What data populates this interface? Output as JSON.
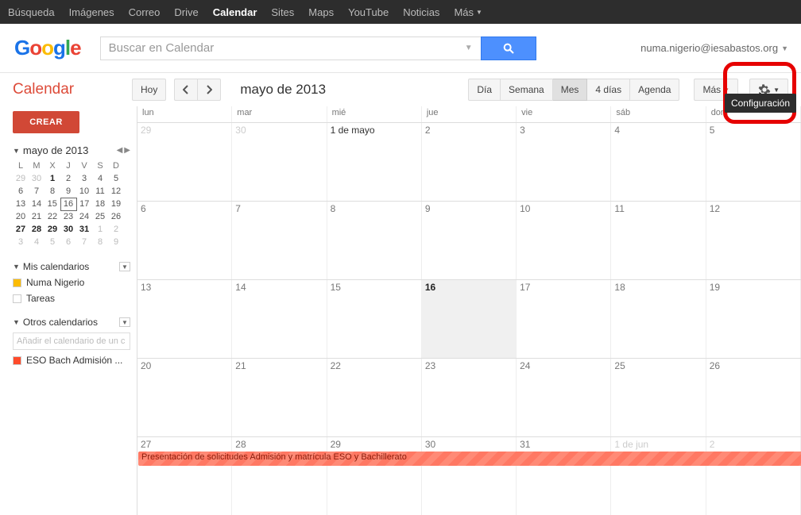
{
  "topnav": {
    "items": [
      "Búsqueda",
      "Imágenes",
      "Correo",
      "Drive",
      "Calendar",
      "Sites",
      "Maps",
      "YouTube",
      "Noticias"
    ],
    "more": "Más",
    "active": 4
  },
  "logo_letters": [
    "G",
    "o",
    "o",
    "g",
    "l",
    "e"
  ],
  "search": {
    "placeholder": "Buscar en Calendar"
  },
  "user": {
    "email": "numa.nigerio@iesabastos.org"
  },
  "app": {
    "title": "Calendar"
  },
  "toolbar": {
    "today": "Hoy",
    "month": "mayo de 2013",
    "views": [
      "Día",
      "Semana",
      "Mes",
      "4 días",
      "Agenda"
    ],
    "selected_view": 2,
    "more": "Más"
  },
  "tooltip": "Configuración",
  "sidebar": {
    "create": "CREAR",
    "mini": {
      "label": "mayo de 2013",
      "dow": [
        "L",
        "M",
        "X",
        "J",
        "V",
        "S",
        "D"
      ],
      "rows": [
        [
          {
            "n": "29",
            "dim": true
          },
          {
            "n": "30",
            "dim": true
          },
          {
            "n": "1",
            "b": true
          },
          {
            "n": "2"
          },
          {
            "n": "3"
          },
          {
            "n": "4"
          },
          {
            "n": "5"
          }
        ],
        [
          {
            "n": "6"
          },
          {
            "n": "7"
          },
          {
            "n": "8"
          },
          {
            "n": "9"
          },
          {
            "n": "10"
          },
          {
            "n": "11"
          },
          {
            "n": "12"
          }
        ],
        [
          {
            "n": "13"
          },
          {
            "n": "14"
          },
          {
            "n": "15"
          },
          {
            "n": "16",
            "today": true
          },
          {
            "n": "17"
          },
          {
            "n": "18"
          },
          {
            "n": "19"
          }
        ],
        [
          {
            "n": "20"
          },
          {
            "n": "21"
          },
          {
            "n": "22"
          },
          {
            "n": "23"
          },
          {
            "n": "24"
          },
          {
            "n": "25"
          },
          {
            "n": "26"
          }
        ],
        [
          {
            "n": "27",
            "b": true
          },
          {
            "n": "28",
            "b": true
          },
          {
            "n": "29",
            "b": true
          },
          {
            "n": "30",
            "b": true
          },
          {
            "n": "31",
            "b": true
          },
          {
            "n": "1",
            "dim": true
          },
          {
            "n": "2",
            "dim": true
          }
        ],
        [
          {
            "n": "3",
            "dim": true
          },
          {
            "n": "4",
            "dim": true
          },
          {
            "n": "5",
            "dim": true
          },
          {
            "n": "6",
            "dim": true
          },
          {
            "n": "7",
            "dim": true
          },
          {
            "n": "8",
            "dim": true
          },
          {
            "n": "9",
            "dim": true
          }
        ]
      ]
    },
    "mycals": {
      "title": "Mis calendarios",
      "items": [
        {
          "label": "Numa Nigerio",
          "color": "#fbbc05"
        },
        {
          "label": "Tareas",
          "color": "#ffffff"
        }
      ]
    },
    "othercals": {
      "title": "Otros calendarios",
      "add_placeholder": "Añadir el calendario de un c",
      "items": [
        {
          "label": "ESO Bach Admisión ...",
          "color": "#ff4b2b"
        }
      ]
    }
  },
  "grid": {
    "dow": [
      "lun",
      "mar",
      "mié",
      "jue",
      "vie",
      "sáb",
      "dom"
    ],
    "weeks": [
      [
        {
          "n": "29",
          "dim": true
        },
        {
          "n": "30",
          "dim": true
        },
        {
          "n": "1 de mayo",
          "first": true
        },
        {
          "n": "2"
        },
        {
          "n": "3"
        },
        {
          "n": "4"
        },
        {
          "n": "5"
        }
      ],
      [
        {
          "n": "6"
        },
        {
          "n": "7"
        },
        {
          "n": "8"
        },
        {
          "n": "9"
        },
        {
          "n": "10"
        },
        {
          "n": "11"
        },
        {
          "n": "12"
        }
      ],
      [
        {
          "n": "13"
        },
        {
          "n": "14"
        },
        {
          "n": "15"
        },
        {
          "n": "16",
          "today": true
        },
        {
          "n": "17"
        },
        {
          "n": "18"
        },
        {
          "n": "19"
        }
      ],
      [
        {
          "n": "20"
        },
        {
          "n": "21"
        },
        {
          "n": "22"
        },
        {
          "n": "23"
        },
        {
          "n": "24"
        },
        {
          "n": "25"
        },
        {
          "n": "26"
        }
      ],
      [
        {
          "n": "27"
        },
        {
          "n": "28"
        },
        {
          "n": "29"
        },
        {
          "n": "30"
        },
        {
          "n": "31"
        },
        {
          "n": "1 de jun",
          "dim": true
        },
        {
          "n": "2",
          "dim": true
        }
      ]
    ],
    "event": {
      "row": 4,
      "start": 0,
      "span": 7,
      "label": "Presentación de solicitudes Admisión y matrícula ESO y Bachillerato"
    }
  }
}
